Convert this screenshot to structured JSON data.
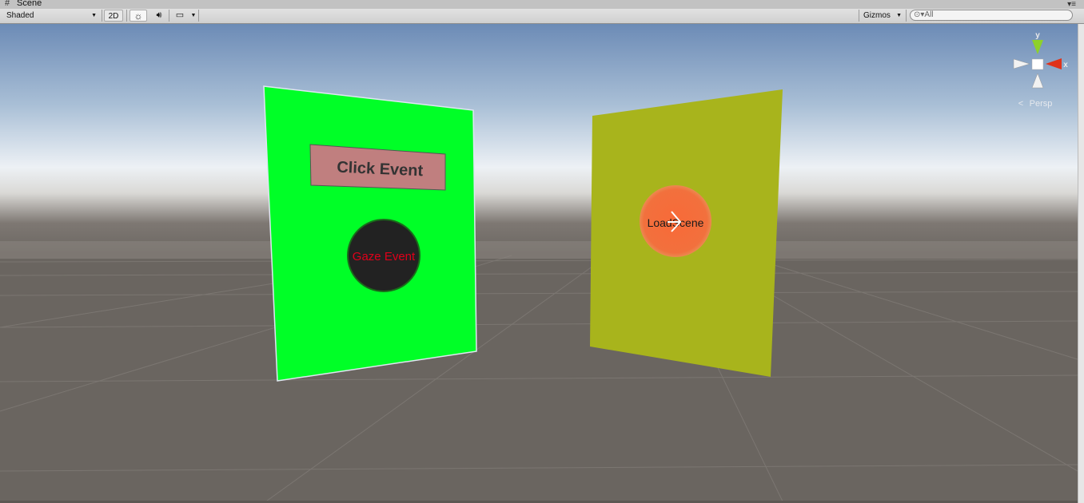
{
  "window": {
    "tab_title": "Scene",
    "tab_icon": "scene-hash-icon",
    "menu_icon": "panel-menu-icon"
  },
  "toolbar": {
    "shading_mode": "Shaded",
    "toggle_2d": "2D",
    "lighting_icon": "sun-icon",
    "audio_icon": "speaker-icon",
    "effects_icon": "image-icon",
    "gizmos_label": "Gizmos",
    "search_placeholder": "All"
  },
  "scene": {
    "colors": {
      "sky_top": "#6e8fba",
      "horizon": "#f2f5f8",
      "ground": "#6a6560",
      "green_panel": "#00ff27",
      "yellow_panel": "#a8b41c",
      "click_button": "#c07f7f",
      "gaze_circle": "#222222",
      "gaze_text": "#e0001a",
      "load_circle": "#f36a3a"
    },
    "green_panel": {
      "click_button_label": "Click Event",
      "gaze_label": "Gaze Event"
    },
    "yellow_panel": {
      "load_label": "LoadScene"
    }
  },
  "orientation_gizmo": {
    "y_label": "y",
    "x_label": "x",
    "projection_label": "Persp"
  }
}
